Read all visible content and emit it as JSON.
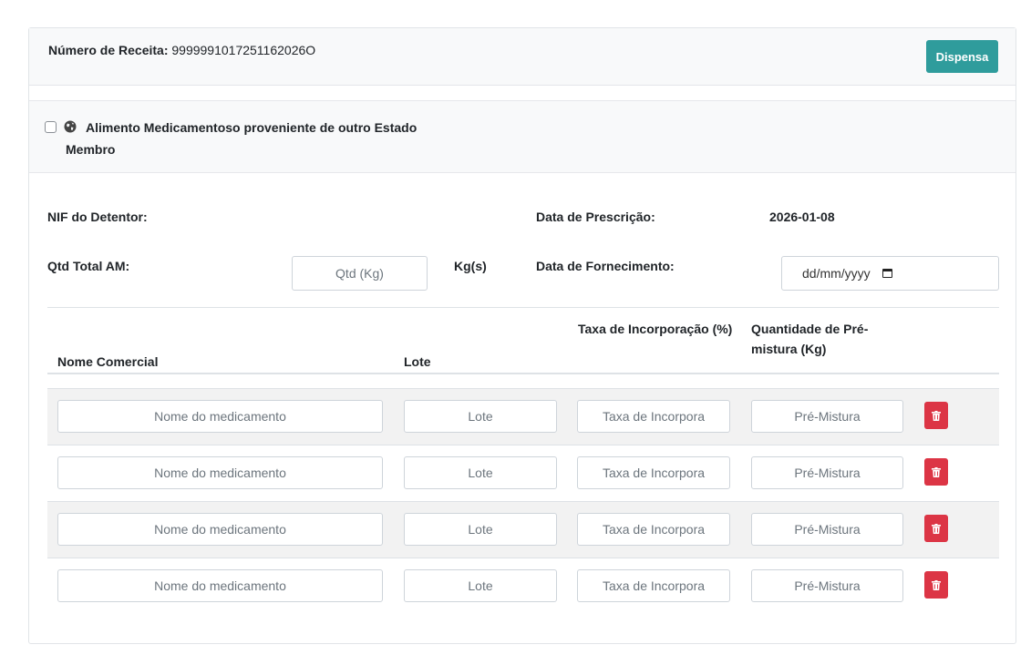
{
  "header": {
    "receita_label": "Número de Receita:",
    "receita_value": "9999991017251162026O",
    "dispensa_label": "Dispensa"
  },
  "outro_estado": {
    "label": "Alimento Medicamentoso proveniente de outro Estado Membro",
    "checked": false,
    "icon": "globe-icon"
  },
  "form": {
    "nif_label": "NIF do Detentor:",
    "nif_value": "",
    "data_prescricao_label": "Data de Prescrição:",
    "data_prescricao_value": "2026-01-08",
    "qtd_total_label": "Qtd Total AM:",
    "qtd_placeholder": "Qtd (Kg)",
    "kgs_label": "Kg(s)",
    "data_fornecimento_label": "Data de Fornecimento:",
    "data_fornecimento_placeholder": "dd/mm/yyyy"
  },
  "table": {
    "headers": {
      "nome": "Nome Comercial",
      "lote": "Lote",
      "taxa": "Taxa de Incorporação (%)",
      "premistura": "Quantidade de Pré-mistura (Kg)"
    },
    "placeholders": {
      "nome": "Nome do medicamento",
      "lote": "Lote",
      "taxa": "Taxa de Incorpora",
      "premistura": "Pré-Mistura"
    },
    "rows": [
      {
        "nome": "",
        "lote": "",
        "taxa": "",
        "premistura": ""
      },
      {
        "nome": "",
        "lote": "",
        "taxa": "",
        "premistura": ""
      },
      {
        "nome": "",
        "lote": "",
        "taxa": "",
        "premistura": ""
      },
      {
        "nome": "",
        "lote": "",
        "taxa": "",
        "premistura": ""
      }
    ]
  },
  "colors": {
    "accent": "#2f9c9c",
    "danger": "#dc3545"
  }
}
